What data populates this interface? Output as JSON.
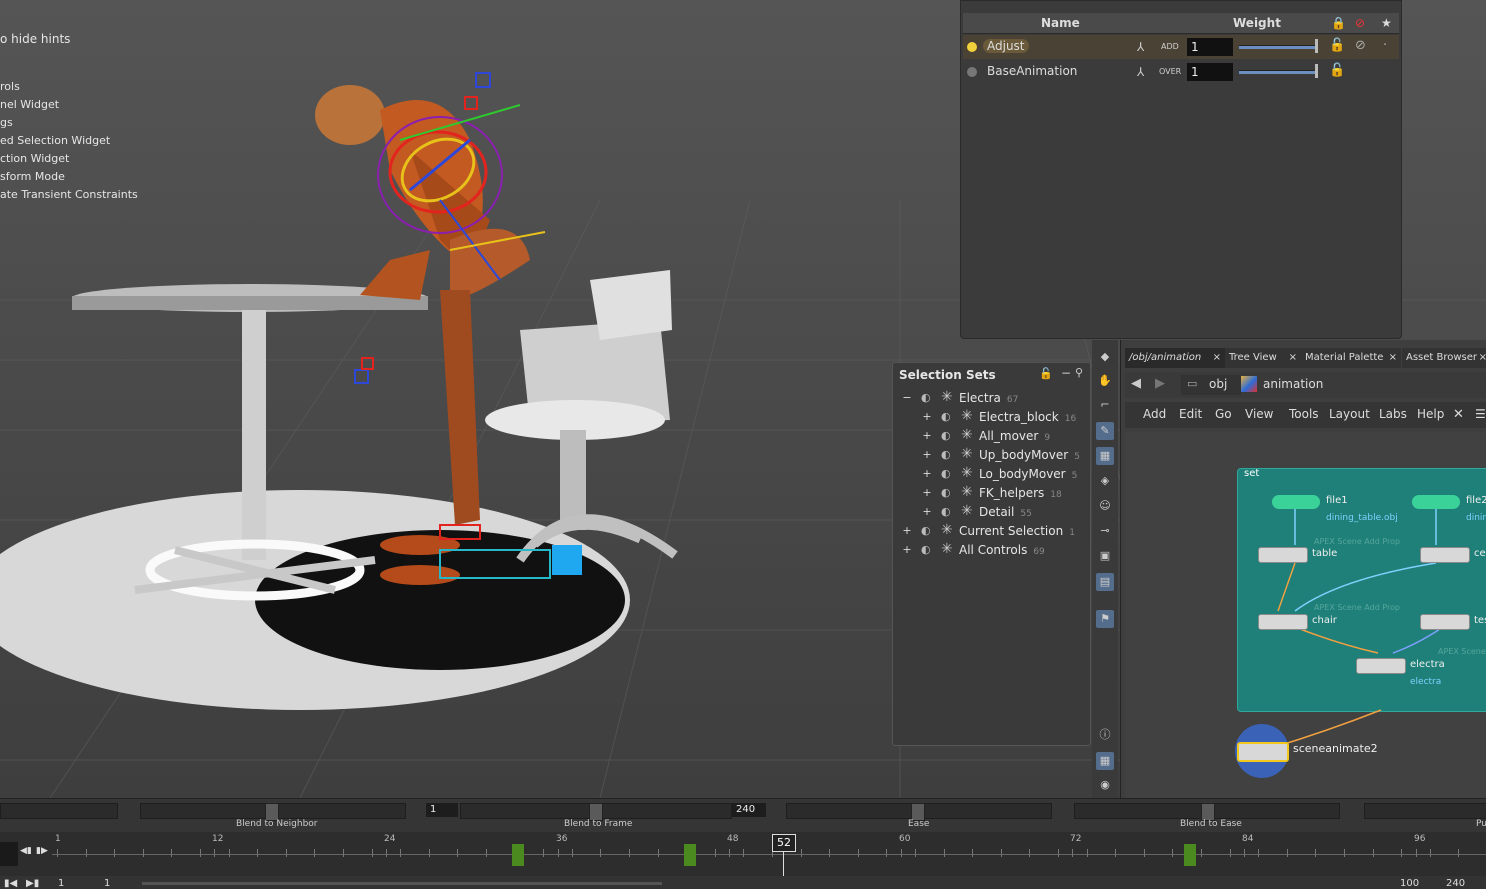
{
  "viewport": {
    "hints": [
      "o hide hints",
      "rols",
      "nel Widget",
      "gs",
      "ed Selection Widget",
      "ction Widget",
      "sform Mode",
      "ate Transient Constraints"
    ]
  },
  "layers": {
    "col_name": "Name",
    "col_weight": "Weight",
    "rows": [
      {
        "name": "Adjust",
        "mode": "ADD",
        "value": "1",
        "dot_color": "#f2d23a",
        "active": true
      },
      {
        "name": "BaseAnimation",
        "mode": "OVER",
        "value": "1",
        "dot_color": "#777777",
        "active": false
      }
    ]
  },
  "selection_sets": {
    "title": "Selection Sets",
    "items": [
      {
        "label": "Electra",
        "count": "67",
        "toggle": "−",
        "indent": 0
      },
      {
        "label": "Electra_block",
        "count": "16",
        "toggle": "+",
        "indent": 1
      },
      {
        "label": "All_mover",
        "count": "9",
        "toggle": "+",
        "indent": 1
      },
      {
        "label": "Up_bodyMover",
        "count": "5",
        "toggle": "+",
        "indent": 1
      },
      {
        "label": "Lo_bodyMover",
        "count": "5",
        "toggle": "+",
        "indent": 1
      },
      {
        "label": "FK_helpers",
        "count": "18",
        "toggle": "+",
        "indent": 1
      },
      {
        "label": "Detail",
        "count": "55",
        "toggle": "+",
        "indent": 1
      },
      {
        "label": "Current Selection",
        "count": "1",
        "toggle": "+",
        "indent": 0
      },
      {
        "label": "All Controls",
        "count": "69",
        "toggle": "+",
        "indent": 0
      }
    ]
  },
  "network": {
    "tabs": [
      "/obj/animation",
      "Tree View",
      "Material Palette",
      "Asset Browser"
    ],
    "path": {
      "root": "obj",
      "current": "animation"
    },
    "menu": [
      "Add",
      "Edit",
      "Go",
      "View",
      "Tools",
      "Layout",
      "Labs",
      "Help"
    ],
    "subnet_name": "set",
    "nodes": {
      "file1": "file1",
      "file1_sub": "dining_table.obj",
      "file2": "file2",
      "file2_sub": "dinin",
      "table": "table",
      "cer": "cer",
      "chair": "chair",
      "tes": "tes",
      "electra": "electra",
      "electra_sub": "electra",
      "ghost1": "APEX Scene Add Prop",
      "ghost2": "APEX Scene Add Prop",
      "ghost3": "APEX Scene Add C",
      "sceneanimate": "sceneanimate2"
    }
  },
  "blend": {
    "labels": [
      "Blend to Neighbor",
      "Blend to Frame",
      "Ease",
      "Blend to Ease",
      "Pu"
    ],
    "start_field": "1",
    "end_field": "240"
  },
  "timeline": {
    "ticks": [
      "1",
      "12",
      "24",
      "36",
      "48",
      "60",
      "72",
      "84",
      "96"
    ],
    "current_frame": "52"
  },
  "bottom": {
    "start": "1",
    "start2": "1",
    "end1": "100",
    "end2": "240"
  }
}
